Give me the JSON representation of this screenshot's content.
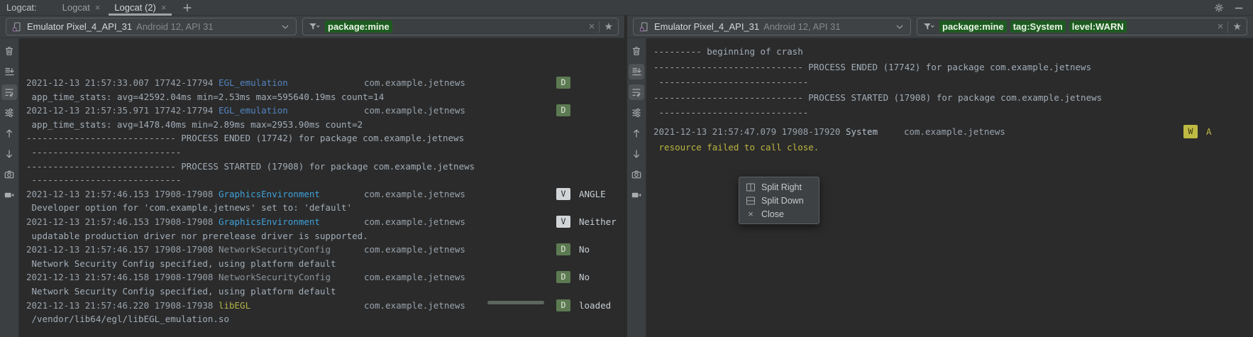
{
  "header": {
    "label": "Logcat:",
    "tabs": [
      {
        "label": "Logcat",
        "active": false,
        "close_icon": "close-icon"
      },
      {
        "label": "Logcat (2)",
        "active": true,
        "close_icon": "close-icon"
      }
    ],
    "new_tab_icon": "plus-icon"
  },
  "window_controls": [
    {
      "icon": "gear-icon"
    },
    {
      "icon": "minimize-icon"
    }
  ],
  "panels": [
    {
      "device": {
        "name": "Emulator Pixel_4_API_31",
        "spec": "Android 12, API 31"
      },
      "filter": {
        "tokens": [
          "package:mine"
        ],
        "clear_icon": "clear-filter-icon",
        "favorite_icon": "favorite-star-icon"
      },
      "toolbar": [
        {
          "icon": "trash-icon",
          "selected": false
        },
        {
          "icon": "scroll-to-end-icon",
          "selected": false
        },
        {
          "icon": "soft-wrap-icon",
          "selected": true
        },
        {
          "icon": "settings-sliders-icon",
          "selected": false
        },
        {
          "icon": "arrow-up-icon",
          "selected": false
        },
        {
          "icon": "arrow-down-icon",
          "selected": false
        },
        {
          "icon": "camera-icon",
          "selected": false
        },
        {
          "icon": "video-icon",
          "selected": false
        }
      ],
      "log": [
        {
          "ts": "2021-12-13 21:57:33.007 17742-17794",
          "tag": "EGL_emulation",
          "tag_color": "blue",
          "package": "com.example.jetnews",
          "level": "D",
          "message": ""
        },
        {
          "text": " app_time_stats: avg=42592.04ms min=2.53ms max=595640.19ms count=14"
        },
        {
          "ts": "2021-12-13 21:57:35.971 17742-17794",
          "tag": "EGL_emulation",
          "tag_color": "blue",
          "package": "com.example.jetnews",
          "level": "D",
          "message": ""
        },
        {
          "text": " app_time_stats: avg=1478.40ms min=2.89ms max=2953.90ms count=2"
        },
        {
          "text": "---------------------------- PROCESS ENDED (17742) for package com.example.jetnews"
        },
        {
          "text": " ----------------------------"
        },
        {
          "text": "---------------------------- PROCESS STARTED (17908) for package com.example.jetnews"
        },
        {
          "text": " ----------------------------"
        },
        {
          "ts": "2021-12-13 21:57:46.153 17908-17908",
          "tag": "GraphicsEnvironment",
          "tag_color": "cyan",
          "package": "com.example.jetnews",
          "level": "V",
          "message": "ANGLE"
        },
        {
          "text": " Developer option for 'com.example.jetnews' set to: 'default'"
        },
        {
          "ts": "2021-12-13 21:57:46.153 17908-17908",
          "tag": "GraphicsEnvironment",
          "tag_color": "cyan",
          "package": "com.example.jetnews",
          "level": "V",
          "message": "Neither"
        },
        {
          "text": " updatable production driver nor prerelease driver is supported."
        },
        {
          "ts": "2021-12-13 21:57:46.157 17908-17908",
          "tag": "NetworkSecurityConfig",
          "tag_color": "gray",
          "package": "com.example.jetnews",
          "level": "D",
          "message": "No"
        },
        {
          "text": " Network Security Config specified, using platform default"
        },
        {
          "ts": "2021-12-13 21:57:46.158 17908-17908",
          "tag": "NetworkSecurityConfig",
          "tag_color": "gray",
          "package": "com.example.jetnews",
          "level": "D",
          "message": "No"
        },
        {
          "text": " Network Security Config specified, using platform default"
        },
        {
          "ts": "2021-12-13 21:57:46.220 17908-17938",
          "tag": "libEGL",
          "tag_color": "olive",
          "package": "com.example.jetnews",
          "level": "D",
          "message": "loaded"
        },
        {
          "text": " /vendor/lib64/egl/libEGL_emulation.so"
        }
      ]
    },
    {
      "device": {
        "name": "Emulator Pixel_4_API_31",
        "spec": "Android 12, API 31"
      },
      "filter": {
        "tokens": [
          "package:mine",
          "tag:System",
          "level:WARN"
        ],
        "clear_icon": "clear-filter-icon",
        "favorite_icon": "favorite-star-icon"
      },
      "toolbar": [
        {
          "icon": "trash-icon",
          "selected": false
        },
        {
          "icon": "scroll-to-end-icon",
          "selected": true
        },
        {
          "icon": "soft-wrap-icon",
          "selected": true
        },
        {
          "icon": "settings-sliders-icon",
          "selected": false
        },
        {
          "icon": "arrow-up-icon",
          "selected": false
        },
        {
          "icon": "arrow-down-icon",
          "selected": false
        },
        {
          "icon": "camera-icon",
          "selected": false
        },
        {
          "icon": "video-icon",
          "selected": false
        }
      ],
      "log": [
        {
          "text": "--------- beginning of crash"
        },
        {
          "text": "---------------------------- PROCESS ENDED (17742) for package com.example.jetnews"
        },
        {
          "text": " ----------------------------"
        },
        {
          "text": "---------------------------- PROCESS STARTED (17908) for package com.example.jetnews"
        },
        {
          "text": " ----------------------------"
        },
        {
          "ts": "2021-12-13 21:57:47.079 17908-17920",
          "tag": "System",
          "tag_color": "plain",
          "package": "com.example.jetnews",
          "level": "W",
          "message": "A"
        },
        {
          "text": " resource failed to call close.",
          "warn": true
        }
      ]
    }
  ],
  "context_menu": {
    "items": [
      {
        "icon": "split-right-icon",
        "label": "Split Right"
      },
      {
        "icon": "split-down-icon",
        "label": "Split Down"
      },
      {
        "icon": "close-icon",
        "label": "Close"
      }
    ]
  },
  "colors": {
    "chrome_bg": "#3c3f41",
    "content_bg": "#2b2b2b",
    "filter_token_bg": "#1d5b20",
    "filter_token_text": "#e9f5e6",
    "warn_yellow": "#bfba43",
    "debug_badge_green": "#5c7a52",
    "verbose_badge_gray": "#d2d5d8",
    "tag_blue": "#5285c1",
    "tag_cyan": "#3ea1da",
    "tag_gray": "#8b949c",
    "tag_olive": "#b4b449",
    "log_text": "#a2adb8",
    "timestamp_text": "#98a2ac",
    "device_icon_accent": "#9876aa"
  }
}
